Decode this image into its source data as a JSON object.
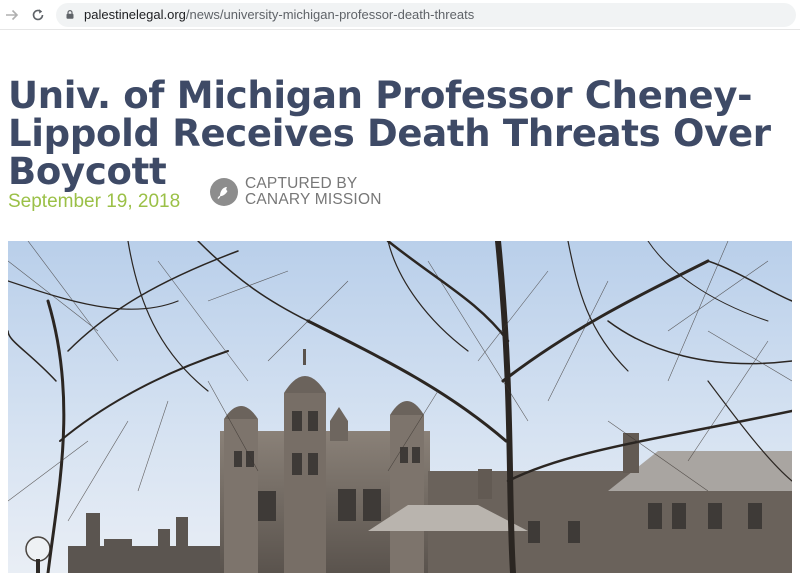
{
  "browser": {
    "url_host": "palestinelegal.org",
    "url_path": "/news/university-michigan-professor-death-threats",
    "forward_icon": "arrow-right-icon",
    "reload_icon": "reload-icon",
    "secure_icon": "lock-icon"
  },
  "article": {
    "title": "Univ. of Michigan Professor Cheney-Lippold Receives Death Threats Over Boycott",
    "date": "September 19, 2018",
    "date_color": "#9bc047",
    "title_color": "#3e4a66"
  },
  "badge": {
    "line1": "CAPTURED BY",
    "line2": "CANARY MISSION",
    "icon": "canary-bird-icon"
  },
  "hero_image": {
    "subject": "campus-gothic-building-photo"
  }
}
